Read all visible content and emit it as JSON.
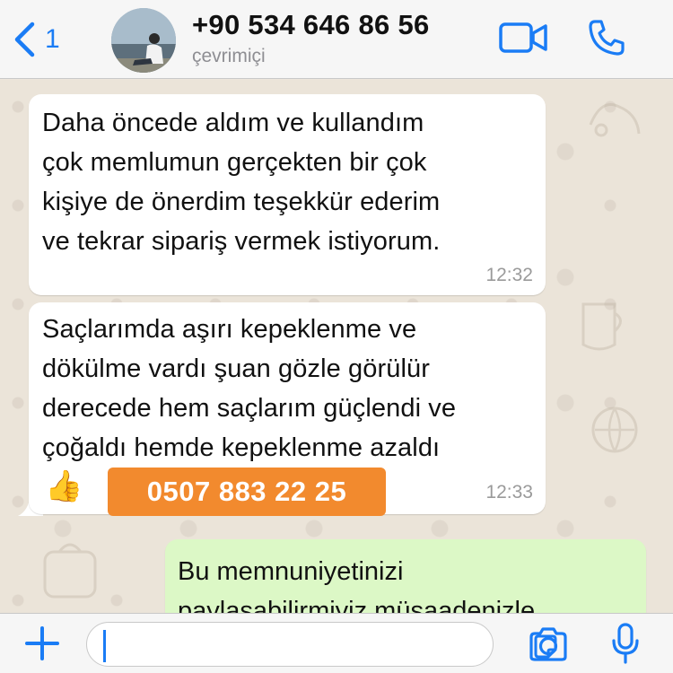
{
  "header": {
    "back_count": "1",
    "contact_name": "+90 534 646 86 56",
    "status": "çevrimiçi",
    "icons": [
      "chevron-left-icon",
      "video-camera-icon",
      "phone-icon"
    ],
    "accent_color": "#1a7cf5"
  },
  "messages": [
    {
      "direction": "incoming",
      "text": "Daha öncede aldım ve kullandım\nçok memlumun gerçekten bir çok\nkişiye de önerdim teşekkür ederim\nve tekrar sipariş vermek istiyorum.",
      "time": "12:32"
    },
    {
      "direction": "incoming",
      "text": "Saçlarımda aşırı kepeklenme ve\ndökülme vardı şuan gözle görülür\nderecede hem saçlarım güçlendi ve\nçoğaldı hemde kepeklenme azaldı",
      "emoji": "👍",
      "time": "12:33"
    },
    {
      "direction": "outgoing",
      "text": "Bu memnuniyetinizi\npaylaşabilirmiyiz müsaadenizle"
    }
  ],
  "overlay": {
    "phone_badge": "0507 883 22 25",
    "badge_color": "#f28a2e"
  },
  "input": {
    "value": "",
    "icons": [
      "plus-icon",
      "sticker-icon",
      "camera-icon",
      "microphone-icon"
    ]
  }
}
